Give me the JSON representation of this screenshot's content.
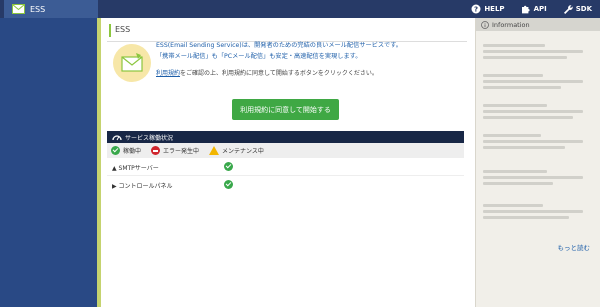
{
  "topbar": {
    "app_tab_label": "ESS",
    "links": [
      {
        "label": "HELP",
        "icon": "help-icon"
      },
      {
        "label": "API",
        "icon": "puzzle-icon"
      },
      {
        "label": "SDK",
        "icon": "wrench-icon"
      }
    ]
  },
  "main": {
    "title": "ESS",
    "description": [
      "ESS(Email Sending Service)は、開発者のための完結の良いメール配信サービスです。",
      "「携帯メール配信」も「PCメール配信」も安定・高速配信を実現します。"
    ],
    "agree_link": "利用規約",
    "agree_text": "をご確認の上、利用規約に同意して開始するボタンをクリックください。",
    "start_button": "利用規約に同意して開始する"
  },
  "status": {
    "title": "サービス稼働状況",
    "legend": [
      {
        "label": "稼働中",
        "type": "ok"
      },
      {
        "label": "エラー発生中",
        "type": "error"
      },
      {
        "label": "メンテナンス中",
        "type": "maintenance"
      }
    ],
    "rows": [
      {
        "label": "SMTPサーバー",
        "state": "ok"
      },
      {
        "label": "コントロールパネル",
        "state": "ok"
      }
    ]
  },
  "info": {
    "title": "Information",
    "more_link": "もっと読む"
  },
  "colors": {
    "topbar": "#273a67",
    "sidebar": "#294985",
    "accent_green": "#3fa844",
    "status_header": "#182746",
    "link_blue": "#1d5ea9"
  }
}
